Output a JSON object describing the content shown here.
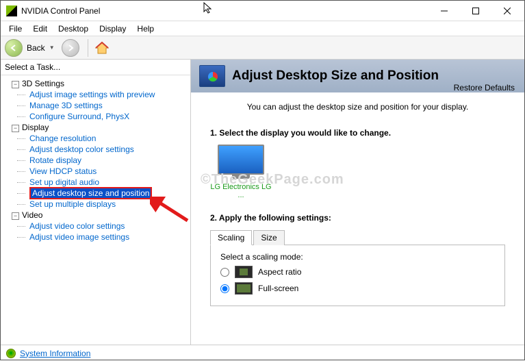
{
  "window": {
    "title": "NVIDIA Control Panel"
  },
  "menu": {
    "file": "File",
    "edit": "Edit",
    "desktop": "Desktop",
    "display": "Display",
    "help": "Help"
  },
  "toolbar": {
    "back": "Back"
  },
  "sidebar": {
    "header": "Select a Task...",
    "cat1": "3D Settings",
    "cat1_items": {
      "a": "Adjust image settings with preview",
      "b": "Manage 3D settings",
      "c": "Configure Surround, PhysX"
    },
    "cat2": "Display",
    "cat2_items": {
      "a": "Change resolution",
      "b": "Adjust desktop color settings",
      "c": "Rotate display",
      "d": "View HDCP status",
      "e": "Set up digital audio",
      "f": "Adjust desktop size and position",
      "g": "Set up multiple displays"
    },
    "cat3": "Video",
    "cat3_items": {
      "a": "Adjust video color settings",
      "b": "Adjust video image settings"
    }
  },
  "main": {
    "title": "Adjust Desktop Size and Position",
    "restore": "Restore Defaults",
    "intro": "You can adjust the desktop size and position for your display.",
    "step1": "1. Select the display you would like to change.",
    "monitor_label": "LG Electronics LG ...",
    "step2": "2. Apply the following settings:",
    "tabs": {
      "scaling": "Scaling",
      "size": "Size"
    },
    "scaling_label": "Select a scaling mode:",
    "opts": {
      "aspect": "Aspect ratio",
      "full": "Full-screen"
    }
  },
  "footer": {
    "sysinfo": "System Information"
  },
  "watermark": "©TheGeekPage.com"
}
